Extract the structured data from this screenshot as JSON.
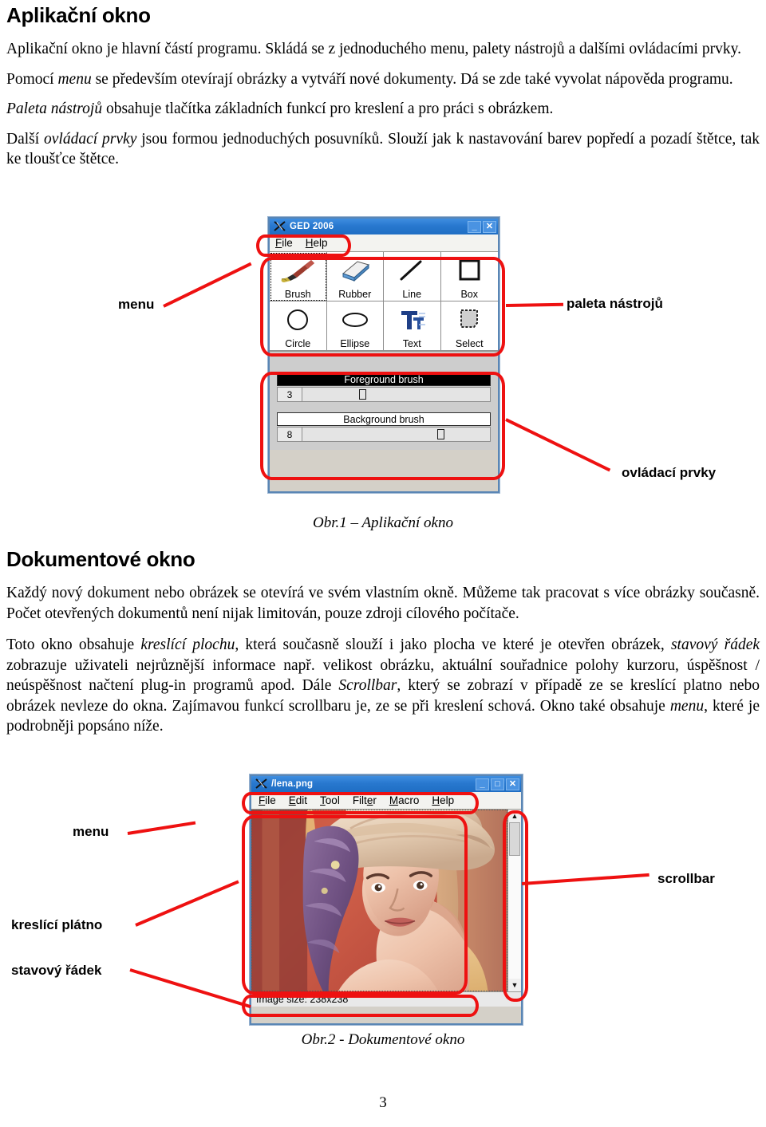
{
  "document": {
    "page_number": "3",
    "heading1": "Aplikační okno",
    "paragraphs": [
      "Aplikační okno je hlavní částí programu. Skládá se z jednoduchého menu, palety nástrojů a dalšími ovládacími prvky.",
      "Pomocí menu se především otevírají obrázky a vytváří nové dokumenty. Dá se zde také vyvolat nápověda programu.",
      "Paleta nástrojů obsahuje tlačítka základních funkcí pro kreslení a pro práci s obrázkem.",
      "Další ovládací prvky jsou formou jednoduchých posuvníků. Slouží jak k nastavování barev popředí a pozadí štětce, tak ke tloušťce štětce."
    ],
    "heading2": "Dokumentové okno",
    "paragraphs2": [
      "Každý nový dokument nebo obrázek se otevírá ve svém vlastním okně. Můžeme tak pracovat s více obrázky současně. Počet otevřených dokumentů není nijak limitován, pouze zdroji cílového počítače.",
      "Toto okno obsahuje kreslící plochu, která současně slouží i jako plocha ve které je otevřen obrázek, stavový řádek zobrazuje uživateli nejrůznější informace např. velikost obrázku, aktuální souřadnice polohy kurzoru, úspěšnost / neúspěšnost načtení plug-in programů apod. Dále Scrollbar, který se zobrazí v případě ze se kreslící platno nebo obrázek nevleze do okna. Zajímavou funkcí scrollbaru je, ze se při kreslení schová. Okno také obsahuje menu, které je podrobněji popsáno níže."
    ],
    "caption1": "Obr.1 – Aplikační okno",
    "caption2": "Obr.2 - Dokumentové okno"
  },
  "figure1": {
    "window_title": "GED 2006",
    "logo": "x-logo-icon",
    "titlebar_buttons": [
      {
        "name": "minimize",
        "glyph": "_"
      },
      {
        "name": "close",
        "glyph": "✕"
      }
    ],
    "menu": [
      {
        "label": "File",
        "accel": "F",
        "rest": "ile"
      },
      {
        "label": "Help",
        "accel": "H",
        "rest": "elp"
      }
    ],
    "tools": [
      {
        "label": "Brush",
        "icon": "paintbrush-icon",
        "selected": true
      },
      {
        "label": "Rubber",
        "icon": "eraser-icon",
        "selected": false
      },
      {
        "label": "Line",
        "icon": "line-icon",
        "selected": false
      },
      {
        "label": "Box",
        "icon": "square-icon",
        "selected": false
      },
      {
        "label": "Circle",
        "icon": "circle-icon",
        "selected": false
      },
      {
        "label": "Ellipse",
        "icon": "ellipse-icon",
        "selected": false
      },
      {
        "label": "Text",
        "icon": "text-tool-icon",
        "selected": false
      },
      {
        "label": "Select",
        "icon": "marquee-select-icon",
        "selected": false
      }
    ],
    "controls": [
      {
        "label": "Foreground brush",
        "swatch_color": "#000000",
        "swatch_text_color": "#ffffff",
        "value": "3",
        "thumb_percent": 30
      },
      {
        "label": "Background brush",
        "swatch_color": "#ffffff",
        "swatch_text_color": "#000000",
        "value": "8",
        "thumb_percent": 72
      }
    ],
    "annotations": [
      {
        "name": "menu",
        "text": "menu"
      },
      {
        "name": "tool-palette",
        "text": "paleta nástrojů"
      },
      {
        "name": "controls",
        "text": "ovládací prvky"
      }
    ]
  },
  "figure2": {
    "window_title": "/lena.png",
    "logo": "x-logo-icon",
    "titlebar_buttons": [
      {
        "name": "minimize",
        "glyph": "_"
      },
      {
        "name": "maximize",
        "glyph": "□"
      },
      {
        "name": "close",
        "glyph": "✕"
      }
    ],
    "menu": [
      {
        "pre": "",
        "accel": "F",
        "post": "ile"
      },
      {
        "pre": "",
        "accel": "E",
        "post": "dit"
      },
      {
        "pre": "",
        "accel": "T",
        "post": "ool"
      },
      {
        "pre": "Filt",
        "accel": "e",
        "post": "r"
      },
      {
        "pre": "",
        "accel": "M",
        "post": "acro"
      },
      {
        "pre": "",
        "accel": "H",
        "post": "elp"
      }
    ],
    "canvas_image": "lena-photo",
    "statusbar_text": "Image size: 238x238",
    "scrollbar": {
      "up_glyph": "▲",
      "down_glyph": "▼",
      "thumb_position_percent": 0
    },
    "annotations": [
      {
        "name": "menu",
        "text": "menu"
      },
      {
        "name": "canvas",
        "text": "kreslící plátno"
      },
      {
        "name": "statusbar",
        "text": "stavový řádek"
      },
      {
        "name": "scrollbar",
        "text": "scrollbar"
      }
    ]
  },
  "colors": {
    "callout_red": "#ee1111",
    "titlebar_blue": "#2878cf",
    "window_face": "#d4d0c8"
  }
}
